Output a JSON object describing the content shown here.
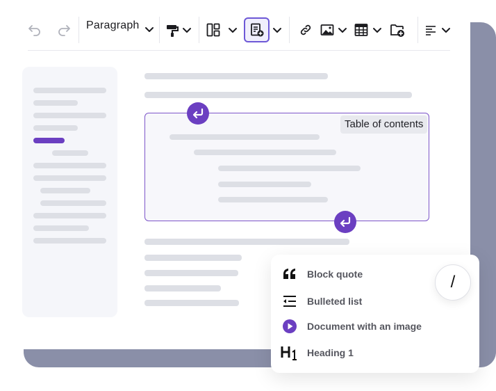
{
  "toolbar": {
    "paragraph_label": "Paragraph"
  },
  "content": {
    "toc_label": "Table of contents"
  },
  "menu": {
    "items": [
      {
        "label": "Block quote",
        "icon": "block-quote-icon"
      },
      {
        "label": "Bulleted list",
        "icon": "bulleted-list-icon"
      },
      {
        "label": "Document with an image",
        "icon": "play-circle-icon"
      },
      {
        "label": "Heading 1",
        "icon": "heading-1-icon"
      }
    ],
    "slash": "/"
  },
  "colors": {
    "accent": "#6b3fc1",
    "placeholder_bar": "#dddfe5"
  }
}
